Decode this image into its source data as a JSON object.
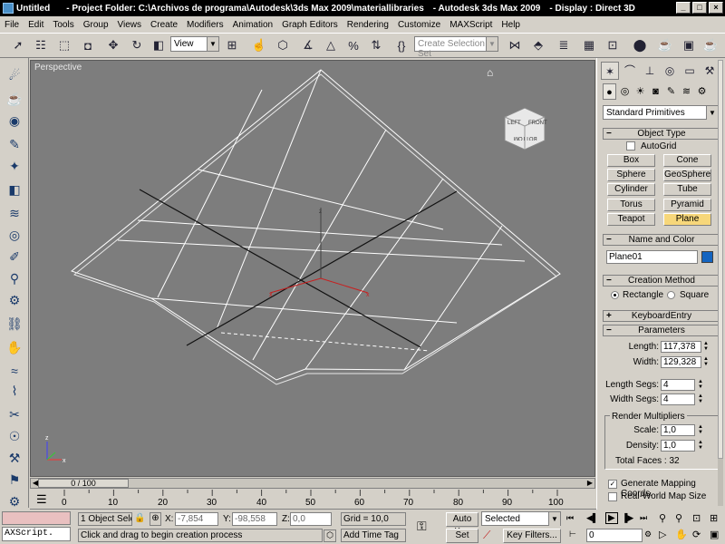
{
  "titlebar": {
    "doc": "Untitled",
    "path": "- Project Folder: C:\\Archivos de programa\\Autodesk\\3ds Max 2009\\materiallibraries",
    "app": "- Autodesk 3ds Max  2009",
    "display": "- Display : Direct 3D"
  },
  "menu": [
    "File",
    "Edit",
    "Tools",
    "Group",
    "Views",
    "Create",
    "Modifiers",
    "Animation",
    "Graph Editors",
    "Rendering",
    "Customize",
    "MAXScript",
    "Help"
  ],
  "toolbar": {
    "ref_coord": "View",
    "selection_set_placeholder": "Create Selection Set"
  },
  "viewport": {
    "label": "Perspective",
    "viewcube": {
      "left": "LEFT",
      "front": "FRONT",
      "bottom": "BOTTOM"
    },
    "colors": {
      "bg": "#7d7d7d",
      "grid": "#ffffff",
      "axis": "#101010",
      "gizmo": "#c82020"
    }
  },
  "timeline": {
    "frame": "0 / 100",
    "ticks": [
      "0",
      "10",
      "20",
      "30",
      "40",
      "50",
      "60",
      "70",
      "80",
      "90",
      "100"
    ]
  },
  "status": {
    "maxscript": "AXScript.",
    "selection": "1 Object Sele",
    "x_label": "X:",
    "x": "-7,854",
    "y_label": "Y:",
    "y": "-98,558",
    "z_label": "Z:",
    "z": "0,0",
    "grid": "Grid = 10,0",
    "prompt": "Click and drag to begin creation process",
    "add_time_tag": "Add Time Tag",
    "auto_key": "Auto Key",
    "set_key": "Set Key",
    "key_mode": "Selected",
    "key_filters": "Key Filters...",
    "current_frame": "0"
  },
  "command_panel": {
    "category": "Standard Primitives",
    "object_type": {
      "title": "Object Type",
      "autogrid": "AutoGrid",
      "buttons": [
        "Box",
        "Cone",
        "Sphere",
        "GeoSphere",
        "Cylinder",
        "Tube",
        "Torus",
        "Pyramid",
        "Teapot",
        "Plane"
      ],
      "active": "Plane"
    },
    "name_color": {
      "title": "Name and Color",
      "name": "Plane01",
      "color": "#1464c0"
    },
    "creation_method": {
      "title": "Creation Method",
      "opt1": "Rectangle",
      "opt2": "Square",
      "selected": "Rectangle"
    },
    "keyboard_entry": {
      "title": "KeyboardEntry"
    },
    "parameters": {
      "title": "Parameters",
      "length_label": "Length:",
      "length": "117,378",
      "width_label": "Width:",
      "width": "129,328",
      "length_segs_label": "Length Segs:",
      "length_segs": "4",
      "width_segs_label": "Width Segs:",
      "width_segs": "4",
      "render_multipliers": "Render Multipliers",
      "scale_label": "Scale:",
      "scale": "1,0",
      "density_label": "Density:",
      "density": "1,0",
      "total_faces": "Total Faces : 32",
      "gen_mapping": "Generate Mapping Coords.",
      "real_world": "Real-World Map Size",
      "gen_mapping_checked": true,
      "real_world_checked": false
    }
  }
}
